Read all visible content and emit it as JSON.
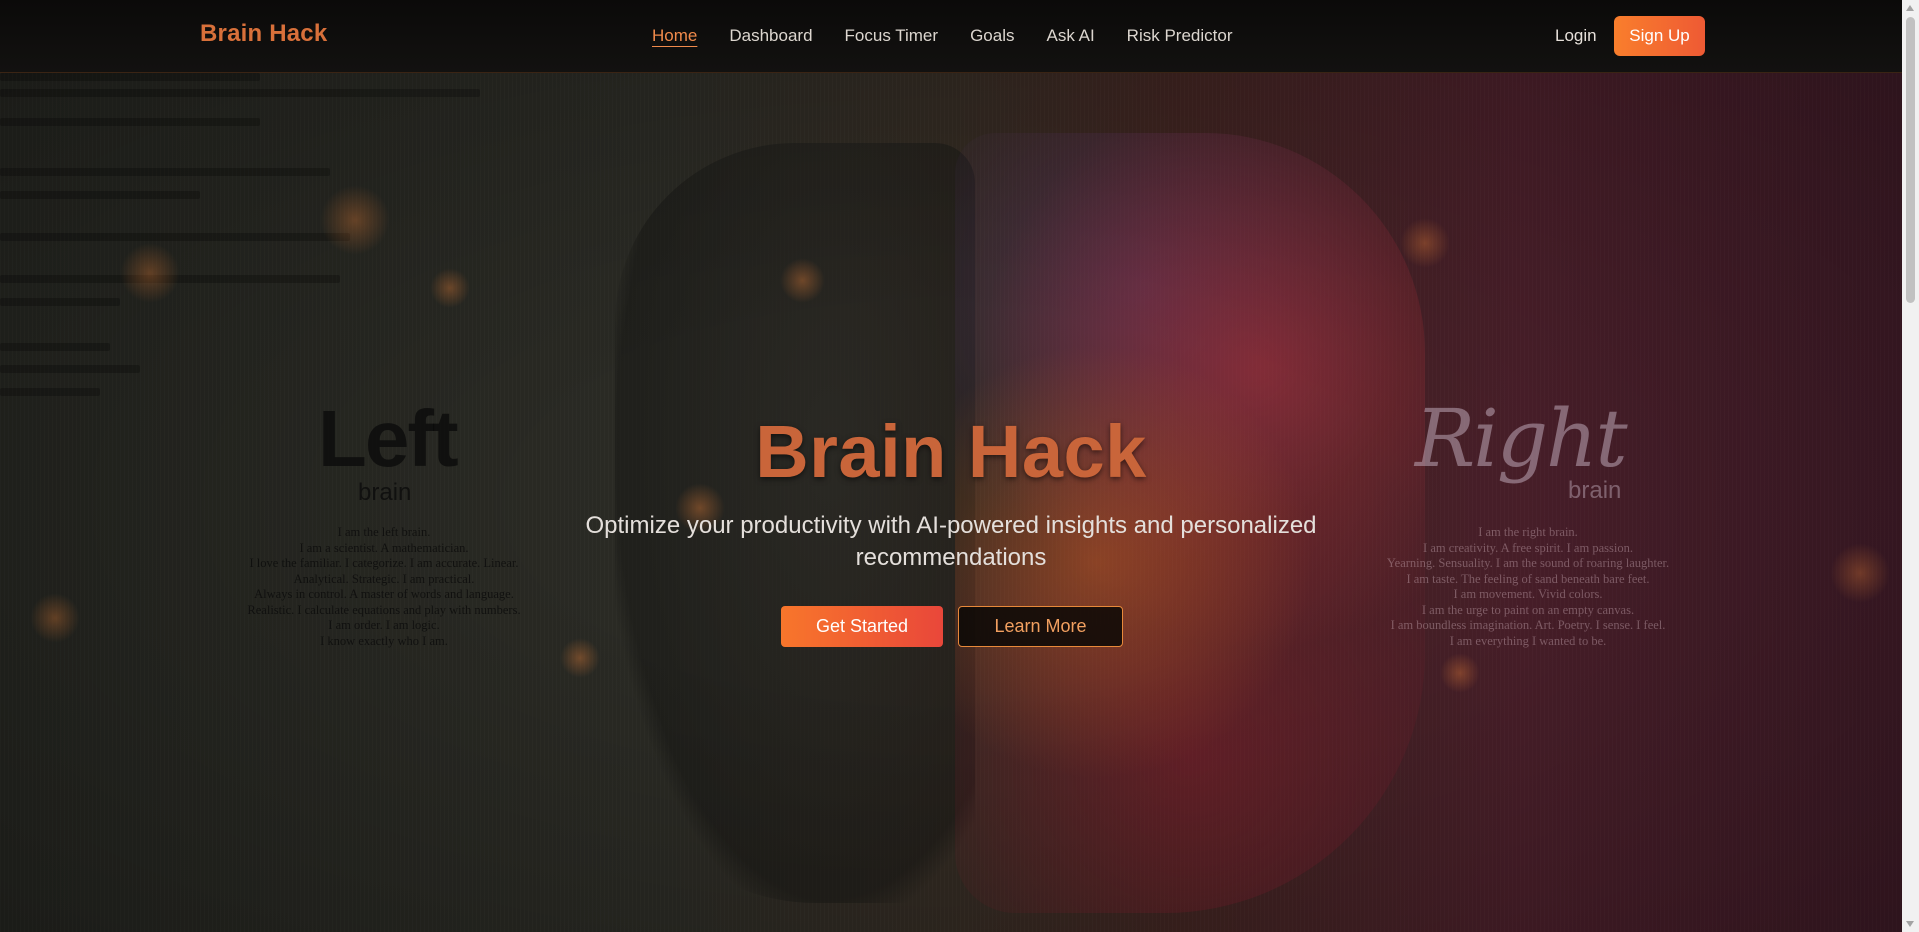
{
  "nav": {
    "brand": "Brain Hack",
    "links": [
      "Home",
      "Dashboard",
      "Focus Timer",
      "Goals",
      "Ask AI",
      "Risk Predictor"
    ],
    "active": "Home",
    "login": "Login",
    "signup": "Sign Up"
  },
  "hero": {
    "title": "Brain Hack",
    "subtitle": "Optimize your productivity with AI-powered insights and personalized recommendations",
    "primary_cta": "Get Started",
    "secondary_cta": "Learn More"
  },
  "background": {
    "left": {
      "title": "Left",
      "sub": "brain",
      "lines": [
        "I am the left brain.",
        "I am a scientist. A mathematician.",
        "I love the familiar. I categorize. I am accurate. Linear.",
        "Analytical. Strategic. I am practical.",
        "Always in control. A master of words and language.",
        "Realistic. I calculate equations and play with numbers.",
        "I am order. I am logic.",
        "I know exactly who I am."
      ]
    },
    "right": {
      "title": "Right",
      "sub": "brain",
      "lines": [
        "I am the right brain.",
        "I am creativity. A free spirit. I am passion.",
        "Yearning. Sensuality. I am the sound of roaring laughter.",
        "I am taste. The feeling of sand beneath bare feet.",
        "I am movement. Vivid colors.",
        "I am the urge to paint on an empty canvas.",
        "I am boundless imagination. Art. Poetry. I sense. I feel.",
        "I am everything I wanted to be."
      ]
    }
  },
  "colors": {
    "accent": "#f97e2c",
    "accent_red": "#ee5a34",
    "brand": "#d8703a",
    "navbar_bg": "#0b0a09"
  }
}
